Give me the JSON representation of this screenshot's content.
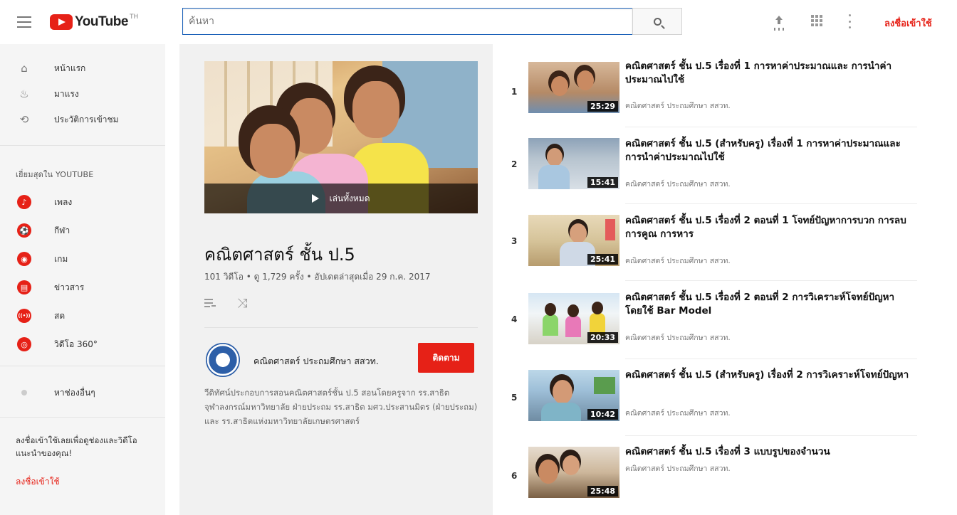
{
  "header": {
    "logo_text": "YouTube",
    "logo_suffix": "TH",
    "search_placeholder": "ค้นหา",
    "signin_label": "ลงชื่อเข้าใช้"
  },
  "sidebar": {
    "nav": [
      {
        "label": "หน้าแรก",
        "icon": "home-icon"
      },
      {
        "label": "มาแรง",
        "icon": "flame-icon"
      },
      {
        "label": "ประวัติการเข้าชม",
        "icon": "history-icon"
      }
    ],
    "section_title": "เยี่ยมสุดใน YOUTUBE",
    "best": [
      {
        "label": "เพลง",
        "icon": "music-icon",
        "glyph": "♪"
      },
      {
        "label": "กีฬา",
        "icon": "sports-icon",
        "glyph": "⚽"
      },
      {
        "label": "เกม",
        "icon": "gaming-icon",
        "glyph": "◉"
      },
      {
        "label": "ข่าวสาร",
        "icon": "news-icon",
        "glyph": "▤"
      },
      {
        "label": "สด",
        "icon": "live-icon",
        "glyph": "((•))"
      },
      {
        "label": "วิดีโอ 360°",
        "icon": "video-360-icon",
        "glyph": "◎"
      }
    ],
    "browse_channels": "หาช่องอื่นๆ",
    "promo_text": "ลงชื่อเข้าใช้เลยเพื่อดูช่องและวิดีโอแนะนำของคุณ!",
    "promo_signin": "ลงชื่อเข้าใช้"
  },
  "playlist": {
    "play_all": "เล่นทั้งหมด",
    "title": "คณิตศาสตร์ ชั้น ป.5",
    "meta": "101 วิดีโอ • ดู 1,729 ครั้ง • อัปเดตล่าสุดเมื่อ 29 ก.ค. 2017",
    "channel_name": "คณิตศาสตร์ ประถมศึกษา สสวท.",
    "subscribe_label": "ติดตาม",
    "description": "วีดิทัศน์ประกอบการสอนคณิตศาสตร์ชั้น ป.5 สอนโดยครูจาก รร.สาธิตจุฬาลงกรณ์มหาวิทยาลัย ฝ่ายประถม รร.สาธิต มศว.ประสานมิตร (ฝ่ายประถม) และ รร.สาธิตแห่งมหาวิทยาลัยเกษตรศาสตร์"
  },
  "videos": [
    {
      "index": "1",
      "title": "คณิตศาสตร์ ชั้น ป.5 เรื่องที่ 1 การหาค่าประมาณและ การนำค่าประมาณไปใช้",
      "channel": "คณิตศาสตร์ ประถมศึกษา สสวท.",
      "duration": "25:29"
    },
    {
      "index": "2",
      "title": "คณิตศาสตร์ ชั้น ป.5 (สำหรับครู) เรื่องที่ 1 การหาค่าประมาณและการนำค่าประมาณไปใช้",
      "channel": "คณิตศาสตร์ ประถมศึกษา สสวท.",
      "duration": "15:41"
    },
    {
      "index": "3",
      "title": "คณิตศาสตร์ ชั้น ป.5 เรื่องที่ 2 ตอนที่ 1 โจทย์ปัญหาการบวก การลบ การคูณ การหาร",
      "channel": "คณิตศาสตร์ ประถมศึกษา สสวท.",
      "duration": "25:41"
    },
    {
      "index": "4",
      "title": "คณิตศาสตร์ ชั้น ป.5 เรื่องที่ 2 ตอนที่ 2 การวิเคราะห์โจทย์ปัญหาโดยใช้ Bar Model",
      "channel": "คณิตศาสตร์ ประถมศึกษา สสวท.",
      "duration": "20:33"
    },
    {
      "index": "5",
      "title": "คณิตศาสตร์ ชั้น ป.5 (สำหรับครู) เรื่องที่ 2 การวิเคราะห์โจทย์ปัญหา",
      "channel": "คณิตศาสตร์ ประถมศึกษา สสวท.",
      "duration": "10:42"
    },
    {
      "index": "6",
      "title": "คณิตศาสตร์ ชั้น ป.5 เรื่องที่ 3 แบบรูปของจำนวน",
      "channel": "คณิตศาสตร์ ประถมศึกษา สสวท.",
      "duration": "25:48"
    }
  ],
  "colors": {
    "accent": "#e62117",
    "sidebar_bg": "#f5f5f5",
    "panel_bg": "#f1f1f1",
    "search_border": "#1c62b9"
  }
}
